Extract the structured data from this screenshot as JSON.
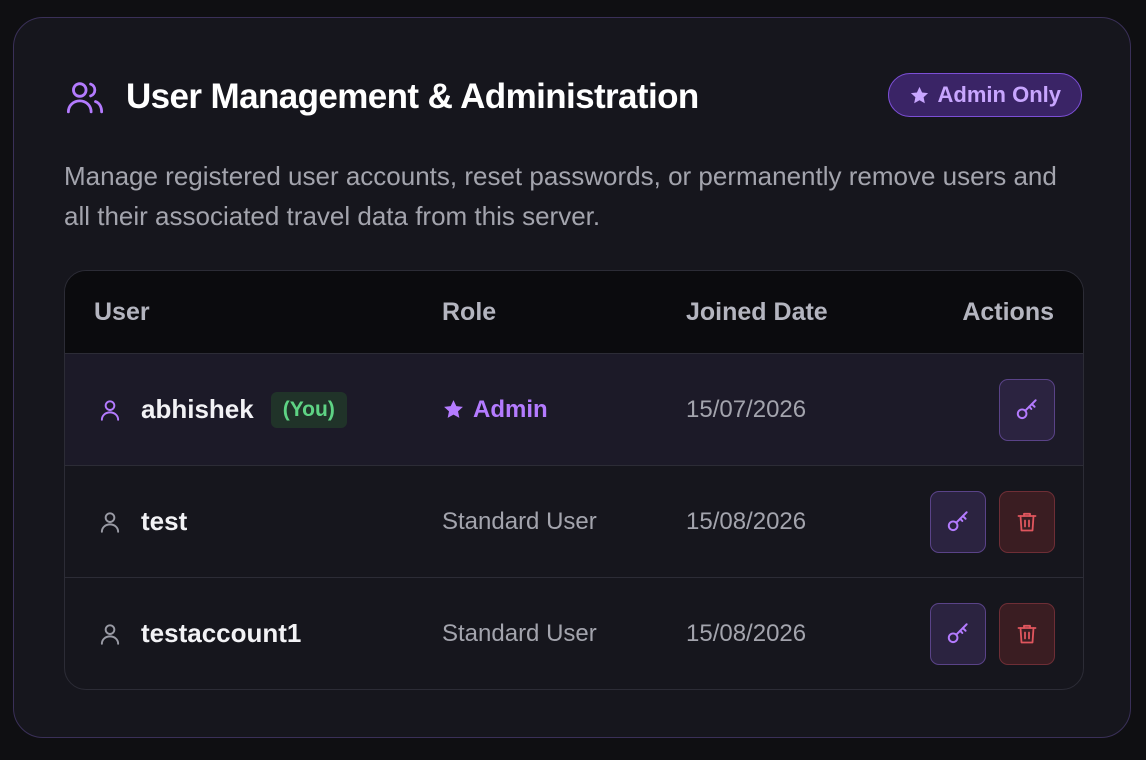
{
  "header": {
    "title": "User Management & Administration",
    "badge_label": "Admin Only"
  },
  "description": "Manage registered user accounts, reset passwords, or permanently remove users and all their associated travel data from this server.",
  "table": {
    "columns": [
      "User",
      "Role",
      "Joined Date",
      "Actions"
    ],
    "rows": [
      {
        "username": "abhishek",
        "you_tag": "(You)",
        "role": "Admin",
        "joined": "15/07/2026",
        "actions": [
          "reset-password"
        ]
      },
      {
        "username": "test",
        "role": "Standard User",
        "joined": "15/08/2026",
        "actions": [
          "reset-password",
          "delete"
        ]
      },
      {
        "username": "testaccount1",
        "role": "Standard User",
        "joined": "15/08/2026",
        "actions": [
          "reset-password",
          "delete"
        ]
      }
    ]
  },
  "icons": {
    "header": "users-icon",
    "badge": "star-icon",
    "user": "user-icon",
    "reset": "key-icon",
    "delete": "trash-icon"
  },
  "colors": {
    "accent": "#b47bff",
    "danger": "#e0565e",
    "success": "#5ed384"
  }
}
